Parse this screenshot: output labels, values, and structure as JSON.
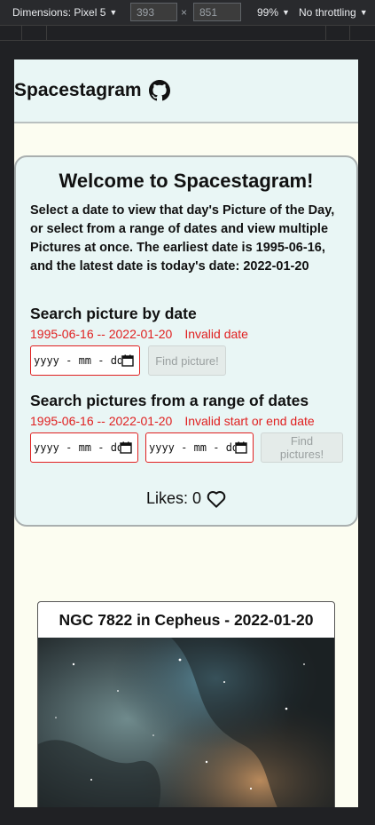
{
  "devtools": {
    "device_label": "Dimensions: Pixel 5",
    "width_value": "393",
    "times": "×",
    "height_value": "851",
    "zoom_label": "99%",
    "throttle_label": "No throttling",
    "icons": [
      "chevron-down-icon"
    ]
  },
  "header": {
    "title": "Spacestagram",
    "icon": "github-icon"
  },
  "welcome": {
    "title": "Welcome to Spacestagram!",
    "intro": "Select a date to view that day's Picture of the Day, or select from a range of dates and view multiple Pictures at once. The earliest date is 1995-06-16, and the latest date is today's date: 2022-01-20"
  },
  "search_single": {
    "heading": "Search picture by date",
    "range_text": "1995-06-16 -- 2022-01-20",
    "error_text": "Invalid date",
    "input_placeholder": "yyyy - mm - dd",
    "button_label": "Find picture!"
  },
  "search_range": {
    "heading": "Search pictures from a range of dates",
    "range_text": "1995-06-16 -- 2022-01-20",
    "error_text": "Invalid start or end date",
    "start_placeholder": "yyyy - mm - dd",
    "end_placeholder": "yyyy - mm - dd",
    "button_label": "Find pictures!"
  },
  "likes": {
    "label": "Likes: 0",
    "icon": "heart-outline-icon"
  },
  "photo": {
    "title": "NGC 7822 in Cepheus - 2022-01-20"
  },
  "colors": {
    "header_bg": "#e9f6f5",
    "page_bg": "#fcfdf1",
    "error": "#e02020"
  }
}
